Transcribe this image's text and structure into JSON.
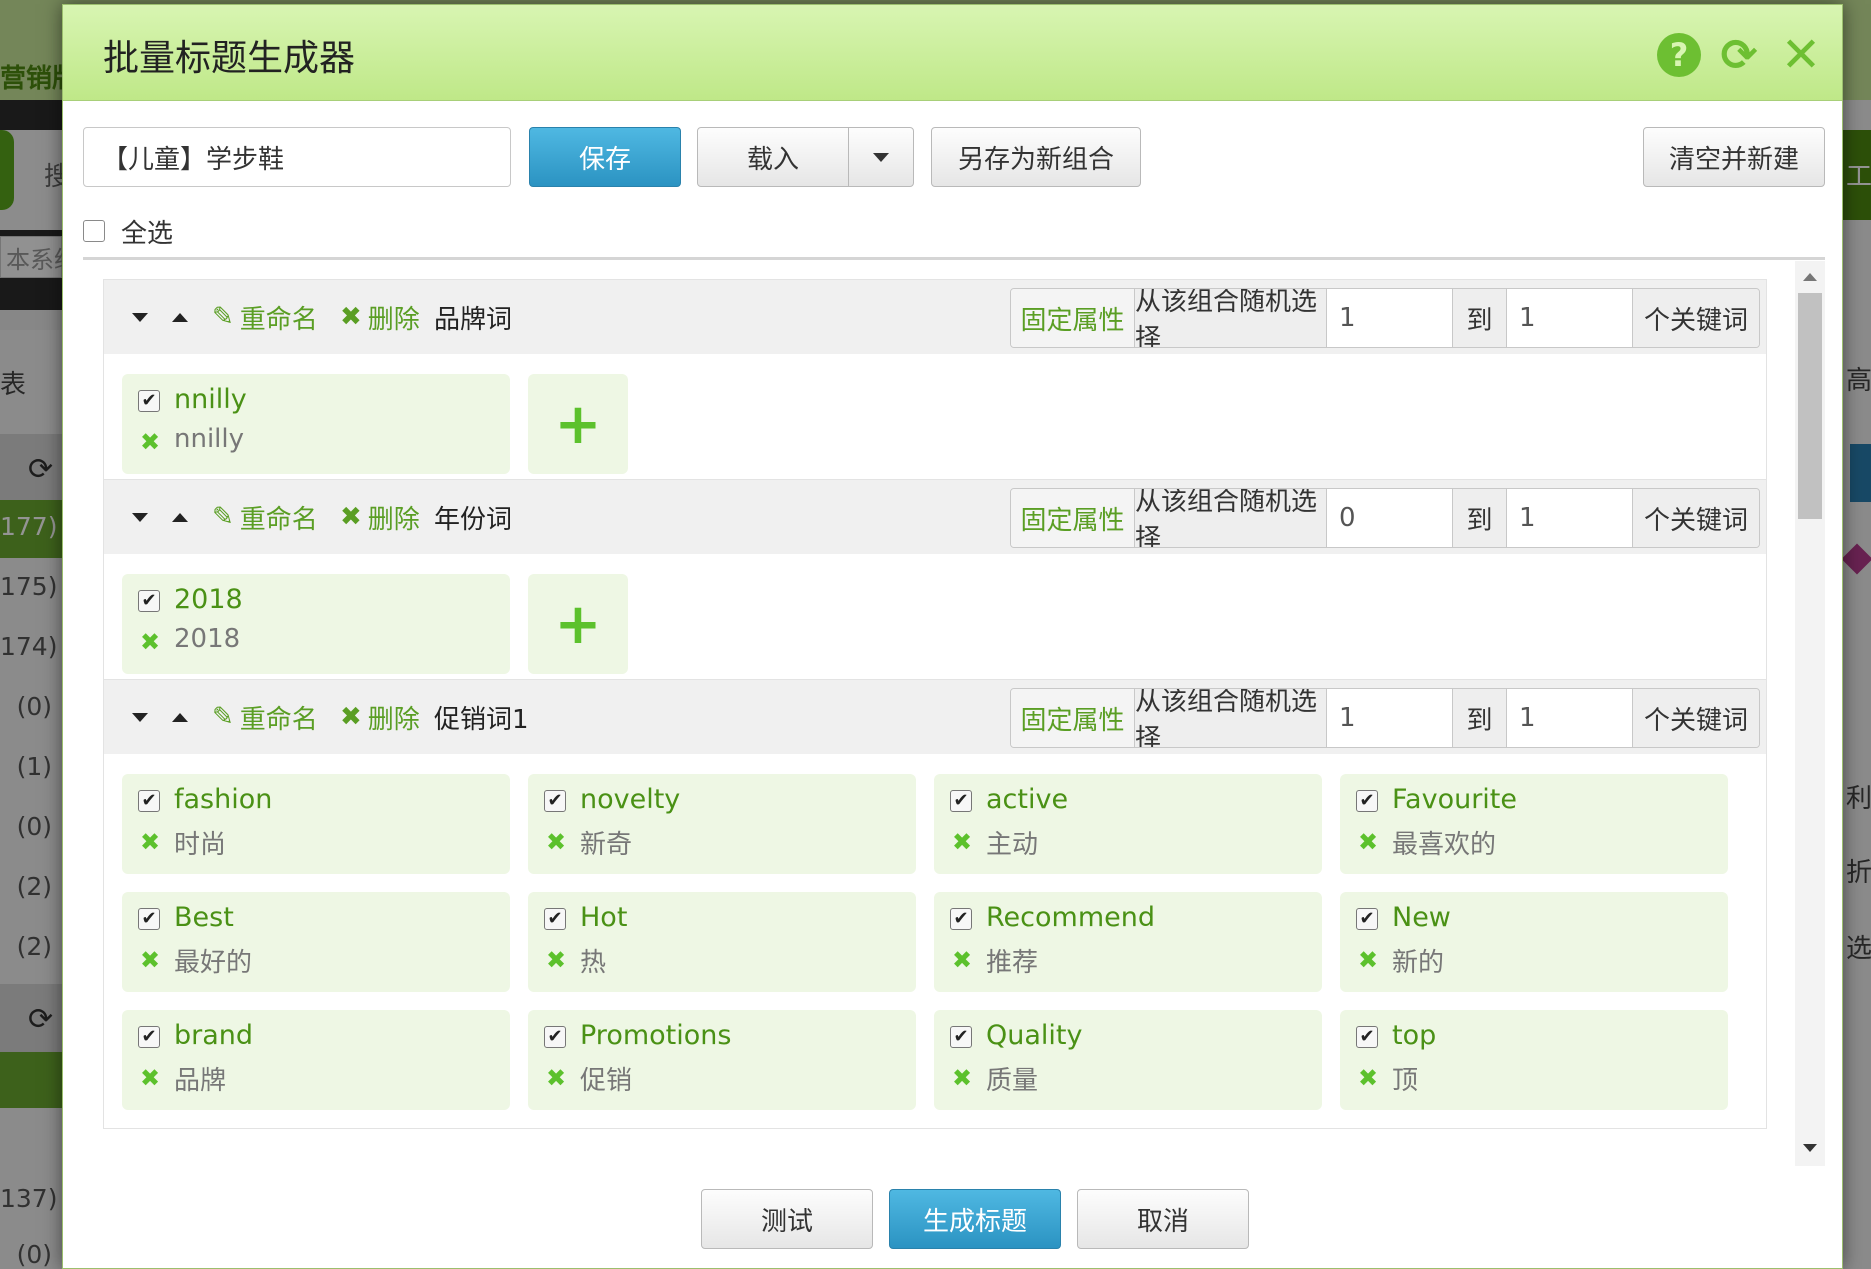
{
  "background": {
    "brand_text": "营销版",
    "search_label": "搜",
    "input_text": "本系统",
    "list_label": "表",
    "counts_a": [
      "177)",
      "175)",
      "174)",
      "(0)",
      "(1)",
      "(0)",
      "(2)",
      "(2)"
    ],
    "counts_b": [
      "137)",
      "(0)"
    ],
    "right_texts": [
      "工",
      "高",
      "利润",
      "折扣",
      "选"
    ]
  },
  "dialog": {
    "title": "批量标题生成器",
    "header_icons": [
      "help-icon",
      "refresh-icon",
      "close-icon"
    ],
    "combo_name": "【儿童】学步鞋",
    "toolbar": {
      "save_label": "保存",
      "load_label": "载入",
      "save_as_label": "另存为新组合",
      "clear_label": "清空并新建"
    },
    "select_all_label": "全选",
    "groups": [
      {
        "name": "品牌词",
        "rename_label": "重命名",
        "delete_label": "删除",
        "fixed_label": "固定属性",
        "random_label": "从该组合随机选择",
        "min": "1",
        "to_label": "到",
        "max": "1",
        "unit_label": "个关键词",
        "keywords": [
          {
            "word": "nnilly",
            "translation": "nnilly",
            "checked": true
          }
        ]
      },
      {
        "name": "年份词",
        "rename_label": "重命名",
        "delete_label": "删除",
        "fixed_label": "固定属性",
        "random_label": "从该组合随机选择",
        "min": "0",
        "to_label": "到",
        "max": "1",
        "unit_label": "个关键词",
        "keywords": [
          {
            "word": "2018",
            "translation": "2018",
            "checked": true
          }
        ]
      },
      {
        "name": "促销词1",
        "rename_label": "重命名",
        "delete_label": "删除",
        "fixed_label": "固定属性",
        "random_label": "从该组合随机选择",
        "min": "1",
        "to_label": "到",
        "max": "1",
        "unit_label": "个关键词",
        "keywords": [
          {
            "word": "fashion",
            "translation": "时尚",
            "checked": true
          },
          {
            "word": "novelty",
            "translation": "新奇",
            "checked": true
          },
          {
            "word": "active",
            "translation": "主动",
            "checked": true
          },
          {
            "word": "Favourite",
            "translation": "最喜欢的",
            "checked": true
          },
          {
            "word": "Best",
            "translation": "最好的",
            "checked": true
          },
          {
            "word": "Hot",
            "translation": "热",
            "checked": true
          },
          {
            "word": "Recommend",
            "translation": "推荐",
            "checked": true
          },
          {
            "word": "New",
            "translation": "新的",
            "checked": true
          },
          {
            "word": "brand",
            "translation": "品牌",
            "checked": true
          },
          {
            "word": "Promotions",
            "translation": "促销",
            "checked": true
          },
          {
            "word": "Quality",
            "translation": "质量",
            "checked": true
          },
          {
            "word": "top",
            "translation": "顶",
            "checked": true
          }
        ]
      }
    ],
    "footer": {
      "test_label": "测试",
      "generate_label": "生成标题",
      "cancel_label": "取消"
    },
    "colors": {
      "header_green": "#c9eb9a",
      "accent_green": "#5a9e24",
      "primary_blue": "#2b93c2",
      "card_bg": "#eef7e4"
    }
  }
}
